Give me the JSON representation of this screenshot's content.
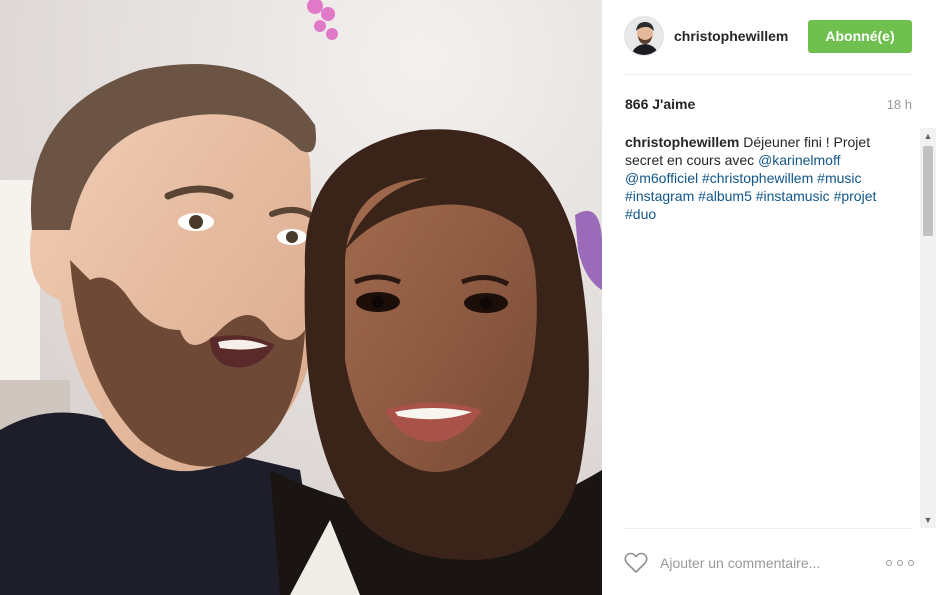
{
  "post": {
    "username": "christophewillem",
    "follow_label": "Abonné(e)",
    "likes": "866 J'aime",
    "time": "18 h",
    "caption": {
      "author": "christophewillem",
      "text": " Déjeuner fini ! Projet secret en cours avec ",
      "mention_1": "@karinelmoff",
      "mention_2": "@m6officiel",
      "hashtags": [
        "#christophewillem",
        "#music",
        "#instagram",
        "#album5",
        "#instamusic",
        "#projet",
        "#duo"
      ]
    },
    "comment_placeholder": "Ajouter un commentaire...",
    "icons": {
      "like": "heart-icon",
      "more": "more-options-icon",
      "scroll_up": "chevron-up-icon",
      "scroll_down": "chevron-down-icon"
    }
  },
  "colors": {
    "follow_button": "#70c050",
    "link": "#125688",
    "muted": "#999999"
  }
}
